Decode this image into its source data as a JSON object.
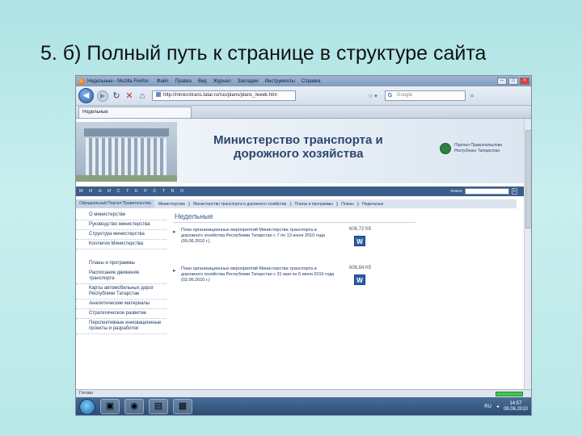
{
  "slide": {
    "title": "5. б) Полный путь к странице в структуре сайта"
  },
  "browser": {
    "window_title": "Недельные - Mozilla Firefox",
    "menu": [
      "Файл",
      "Правка",
      "Вид",
      "Журнал",
      "Закладки",
      "Инструменты",
      "Справка"
    ],
    "url": "http://minicrotrans.tatar.ru/rus/plans/plans_/week.htm",
    "search_placeholder": "Google",
    "tab_label": "Недельные",
    "status_text": "Готово"
  },
  "site": {
    "ministry_title_line1": "Министерство транспорта и",
    "ministry_title_line2": "дорожного хозяйства",
    "emblem_text_line1": "Портал Правительства",
    "emblem_text_line2": "Республики Татарстан",
    "ministry_strip": "М И Н И С Т Е Р С Т В О",
    "search_label": "поиск",
    "search_button": "»",
    "breadcrumb": [
      "Официальный Портал Правительства",
      "Министерства",
      "Министерство транспорта и дорожного хозяйства",
      "Планы и программы",
      "Планы",
      "Недельные"
    ],
    "sidebar_top": [
      "О министерстве",
      "Руководство министерства",
      "Структура министерства",
      "Коллегия Министерства"
    ],
    "sidebar_section": "Планы и программы",
    "sidebar_bottom": [
      "Расписание движения транспорта",
      "Карты автомобильных дорог Республики Татарстан",
      "Аналитические материалы",
      "Стратегическое развитие",
      "Перспективные инновационные проекты и разработки"
    ],
    "page_heading": "Недельные",
    "documents": [
      {
        "text": "План организационных мероприятий Министерства транспорта и дорожного хозяйства Республики Татарстан с 7 по 13 июня 2010 года (09.06.2010 г.)",
        "size": "606,72 Кб"
      },
      {
        "text": "План организационных мероприятий Министерства транспорта и дорожного хозяйства Республики Татарстан с 31 мая по 6 июня 2010 года (02.06.2010 г.)",
        "size": "606,84 Кб"
      }
    ]
  },
  "taskbar": {
    "lang": "RU",
    "time": "14:57",
    "date": "08.06.2010"
  },
  "colors": {
    "slide_bg": "#b9e8e7",
    "site_blue": "#3b5d8a",
    "word_blue": "#2a5fab"
  }
}
